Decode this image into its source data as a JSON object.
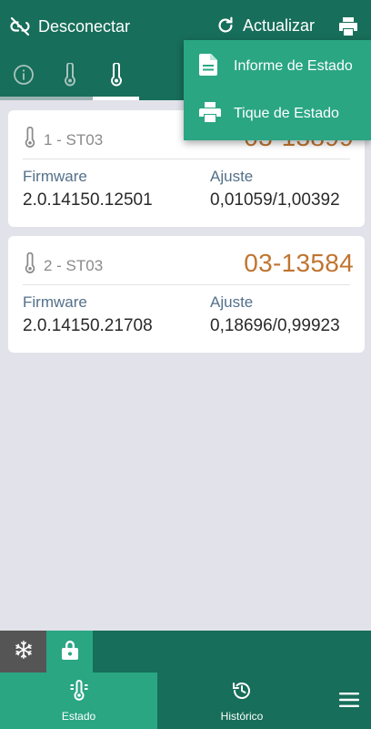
{
  "colors": {
    "primary": "#176e5a",
    "accent": "#2aa683",
    "serial": "#c07531",
    "background": "#e2e2ea",
    "key_text": "#54708a",
    "tab_track": "#9ab3b2",
    "snowflake_button": "#555555"
  },
  "topbar": {
    "disconnect_label": "Desconectar",
    "refresh_label": "Actualizar"
  },
  "tabs": [
    {
      "icon": "info-icon",
      "active": false
    },
    {
      "icon": "thermometer-icon",
      "active": false
    },
    {
      "icon": "thermometer-icon",
      "active": true
    }
  ],
  "print_menu": {
    "items": [
      {
        "label": "Informe de Estado",
        "icon": "document-icon"
      },
      {
        "label": "Tique de Estado",
        "icon": "printer-icon"
      }
    ]
  },
  "sensors": [
    {
      "name": "1 - ST03",
      "serial": "03-13899",
      "firmware_label": "Firmware",
      "firmware": "2.0.14150.12501",
      "adjust_label": "Ajuste",
      "adjust": "0,01059/1,00392"
    },
    {
      "name": "2 - ST03",
      "serial": "03-13584",
      "firmware_label": "Firmware",
      "firmware": "2.0.14150.21708",
      "adjust_label": "Ajuste",
      "adjust": "0,18696/0,99923"
    }
  ],
  "controls": {
    "freeze_icon": "snowflake-icon",
    "lock_icon": "lock-icon"
  },
  "bottom_nav": {
    "items": [
      {
        "label": "Estado",
        "icon": "status-icon",
        "active": true
      },
      {
        "label": "Histórico",
        "icon": "history-icon",
        "active": false
      }
    ],
    "menu_icon": "menu-icon"
  }
}
